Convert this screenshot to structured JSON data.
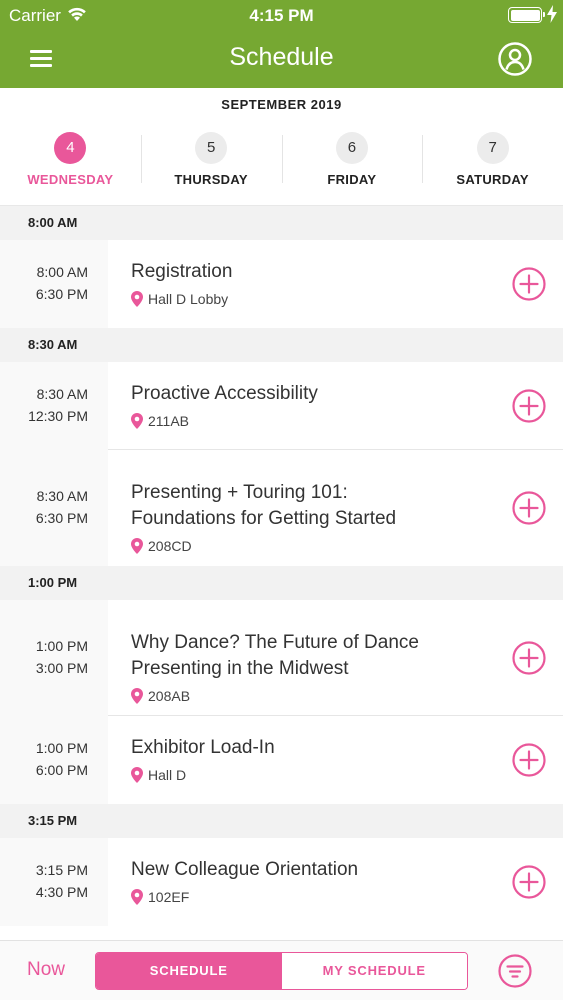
{
  "status": {
    "carrier": "Carrier",
    "time": "4:15 PM",
    "battery_level": 1.0
  },
  "nav": {
    "title": "Schedule"
  },
  "calendar": {
    "month": "SEPTEMBER 2019",
    "days": [
      {
        "num": "4",
        "name": "WEDNESDAY",
        "active": true
      },
      {
        "num": "5",
        "name": "THURSDAY",
        "active": false
      },
      {
        "num": "6",
        "name": "FRIDAY",
        "active": false
      },
      {
        "num": "7",
        "name": "SATURDAY",
        "active": false
      }
    ]
  },
  "groups": [
    {
      "header": "8:00 AM",
      "events": [
        {
          "start": "8:00 AM",
          "end": "6:30 PM",
          "title": [
            "Registration"
          ],
          "location": "Hall D Lobby"
        }
      ]
    },
    {
      "header": "8:30 AM",
      "events": [
        {
          "start": "8:30 AM",
          "end": "12:30 PM",
          "title": [
            "Proactive Accessibility"
          ],
          "location": "211AB"
        },
        {
          "start": "8:30 AM",
          "end": "6:30 PM",
          "title": [
            "Presenting + Touring 101:",
            "Foundations for Getting Started"
          ],
          "location": "208CD"
        }
      ]
    },
    {
      "header": "1:00 PM",
      "events": [
        {
          "start": "1:00 PM",
          "end": "3:00 PM",
          "title": [
            "Why Dance? The Future of Dance",
            "Presenting in the Midwest"
          ],
          "location": "208AB"
        },
        {
          "start": "1:00 PM",
          "end": "6:00 PM",
          "title": [
            "Exhibitor Load-In"
          ],
          "location": "Hall D"
        }
      ]
    },
    {
      "header": "3:15 PM",
      "events": [
        {
          "start": "3:15 PM",
          "end": "4:30 PM",
          "title": [
            "New Colleague Orientation"
          ],
          "location": "102EF"
        }
      ]
    }
  ],
  "bottom": {
    "now": "Now",
    "tabs": [
      "SCHEDULE",
      "MY SCHEDULE"
    ],
    "active_tab": "SCHEDULE"
  },
  "colors": {
    "header_green": "#76a832",
    "accent_pink": "#e9579a"
  },
  "icons": {
    "menu": "hamburger-icon",
    "profile": "user-circle-icon",
    "location": "map-pin-icon",
    "add": "plus-circle-icon",
    "filter": "filter-icon"
  }
}
